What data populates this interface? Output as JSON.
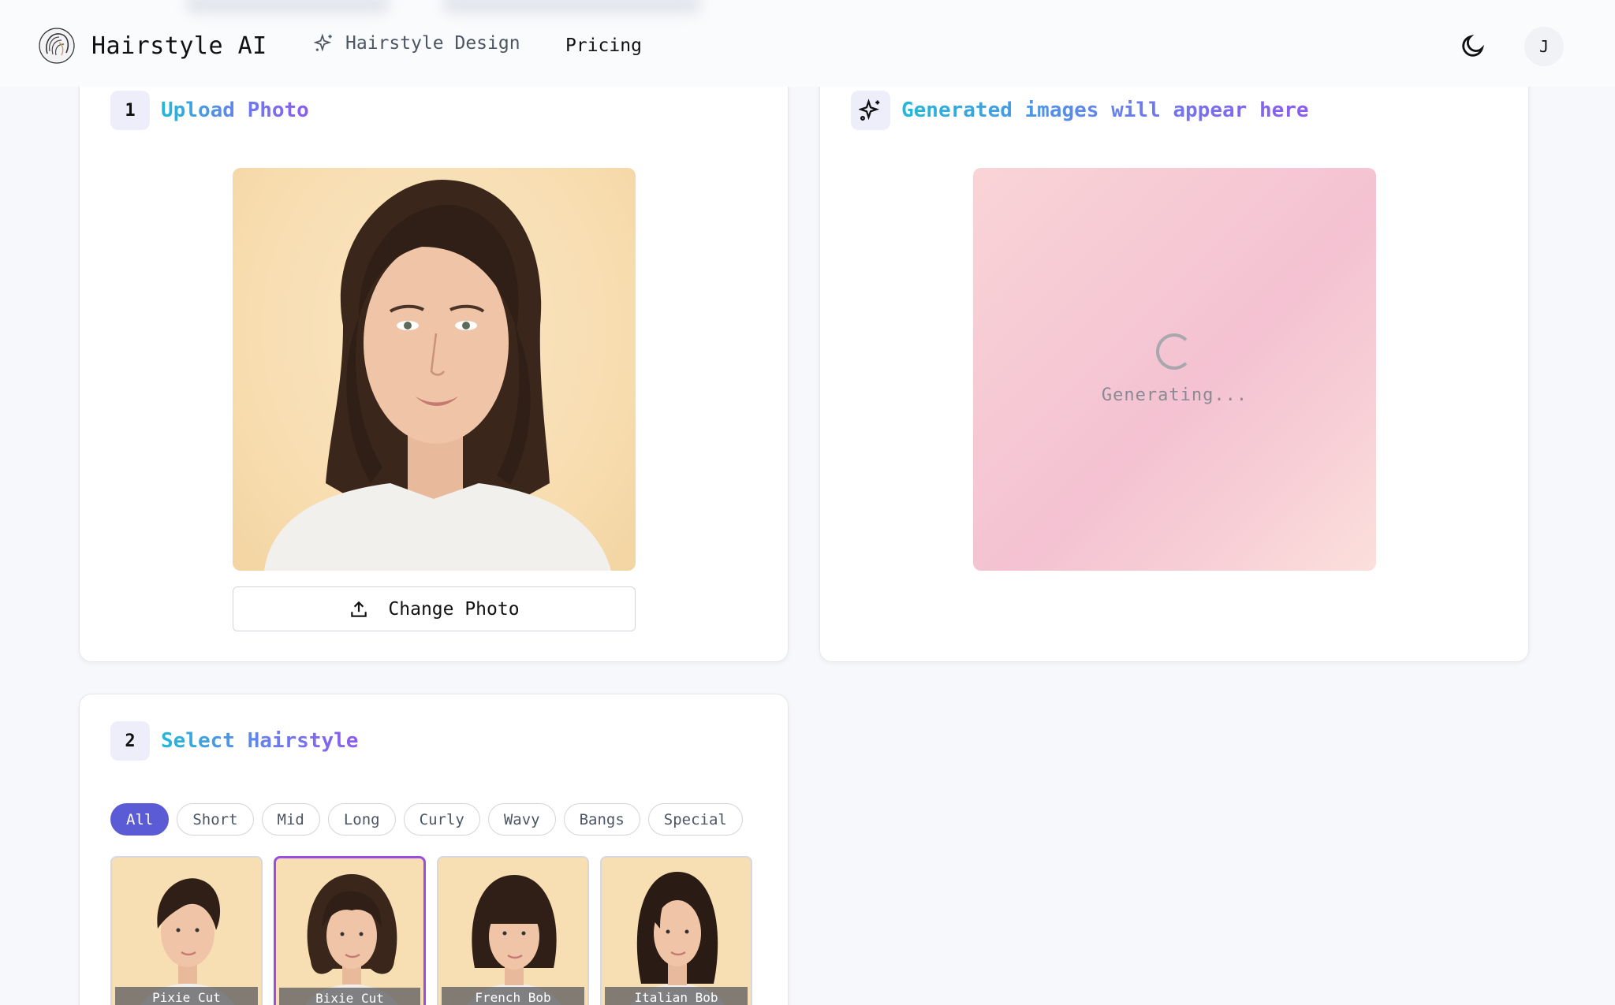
{
  "header": {
    "brand_name": "Hairstyle AI",
    "nav_design": "Hairstyle Design",
    "nav_pricing": "Pricing",
    "avatar_initial": "J",
    "theme_icon": "moon-icon"
  },
  "upload": {
    "step_number": "1",
    "title": "Upload Photo",
    "change_button": "Change Photo",
    "button_icon": "upload-icon"
  },
  "result": {
    "title": "Generated images will appear here",
    "status": "Generating...",
    "icon": "sparkles-icon"
  },
  "select": {
    "step_number": "2",
    "title": "Select Hairstyle",
    "filters": [
      "All",
      "Short",
      "Mid",
      "Long",
      "Curly",
      "Wavy",
      "Bangs",
      "Special"
    ],
    "active_filter": "All",
    "styles": [
      {
        "label": "Pixie Cut",
        "selected": false
      },
      {
        "label": "Bixie Cut",
        "selected": true
      },
      {
        "label": "French Bob",
        "selected": false
      },
      {
        "label": "Italian Bob",
        "selected": false
      }
    ]
  },
  "colors": {
    "accent": "#5b5bd6",
    "selected_border": "#9a4ee0",
    "title_gradient_start": "#22b8d9",
    "title_gradient_end": "#8a5cf0"
  }
}
